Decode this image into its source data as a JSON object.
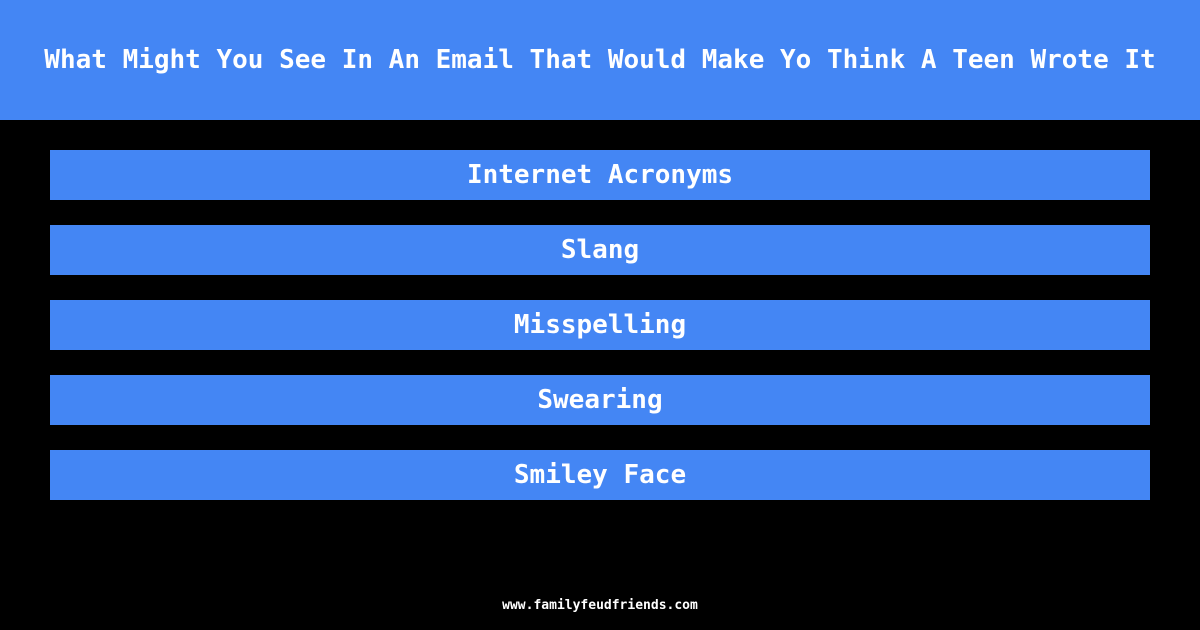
{
  "header": {
    "title": "What Might You See In An Email That Would Make Yo Think A Teen Wrote It"
  },
  "answers": [
    {
      "label": "Internet Acronyms"
    },
    {
      "label": "Slang"
    },
    {
      "label": "Misspelling"
    },
    {
      "label": "Swearing"
    },
    {
      "label": "Smiley Face"
    }
  ],
  "footer": {
    "url": "www.familyfeudfriends.com"
  },
  "colors": {
    "accent": "#4486F4",
    "background": "#000000",
    "text": "#FFFFFF"
  }
}
